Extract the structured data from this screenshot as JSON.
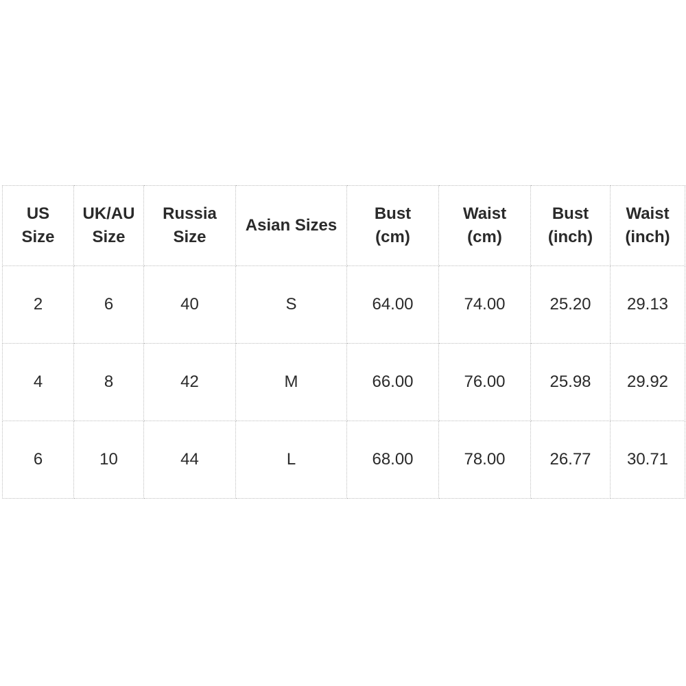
{
  "table": {
    "headers": [
      [
        "US",
        "Size"
      ],
      [
        "UK/AU",
        "Size"
      ],
      [
        "Russia",
        "Size"
      ],
      [
        "Asian Sizes"
      ],
      [
        "Bust",
        "(cm)"
      ],
      [
        "Waist",
        "(cm)"
      ],
      [
        "Bust",
        "(inch)"
      ],
      [
        "Waist",
        "(inch)"
      ]
    ],
    "rows": [
      [
        "2",
        "6",
        "40",
        "S",
        "64.00",
        "74.00",
        "25.20",
        "29.13"
      ],
      [
        "4",
        "8",
        "42",
        "M",
        "66.00",
        "76.00",
        "25.98",
        "29.92"
      ],
      [
        "6",
        "10",
        "44",
        "L",
        "68.00",
        "78.00",
        "26.77",
        "30.71"
      ]
    ]
  }
}
